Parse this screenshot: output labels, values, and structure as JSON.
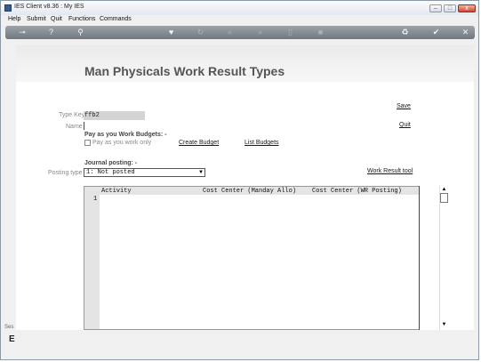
{
  "window": {
    "title": "IES Client v8.36 : My IES"
  },
  "title_controls": {
    "minimize": "–",
    "maximize": "□",
    "close": "x"
  },
  "menu": [
    "Help",
    "Submit",
    "Quit",
    "Functions",
    "Commands"
  ],
  "toolbar": {
    "icons": [
      "key-icon",
      "help-icon",
      "search-icon",
      "heart-icon",
      "refresh-icon",
      "back-icon",
      "forward-icon",
      "document-icon",
      "stop-icon",
      "recycle-icon",
      "confirm-icon",
      "close-icon"
    ],
    "glyphs": [
      "⊸",
      "?",
      "⚲",
      "♥",
      "↻",
      "«",
      "»",
      "▯",
      "■",
      "♻",
      "✔",
      "✕"
    ]
  },
  "page": {
    "title": "Man Physicals Work Result Types"
  },
  "form": {
    "type_key_label": "Type Key",
    "type_key_value": "ffb2",
    "name_label": "Name",
    "save_label": "Save",
    "quit_label": "Quit",
    "pay_heading": "Pay as you Work Budgets: -",
    "pay_checkbox_label": "Pay as you work only",
    "create_budget_label": "Create Budget",
    "list_budgets_label": "List Budgets",
    "journal_heading": "Journal posting: -",
    "posting_type_label": "Posting type",
    "posting_type_value": "1: Not posted",
    "work_result_tool_label": "Work Result tool"
  },
  "grid": {
    "columns": [
      "Activity",
      "Cost Center (Manday Allo)",
      "Cost Center (WR Posting)"
    ],
    "rows": [
      {
        "number": "1"
      }
    ]
  },
  "scrollbar": {
    "up": "▲",
    "down": "▼"
  },
  "side": {
    "session": "Ses",
    "glyph": "E"
  }
}
